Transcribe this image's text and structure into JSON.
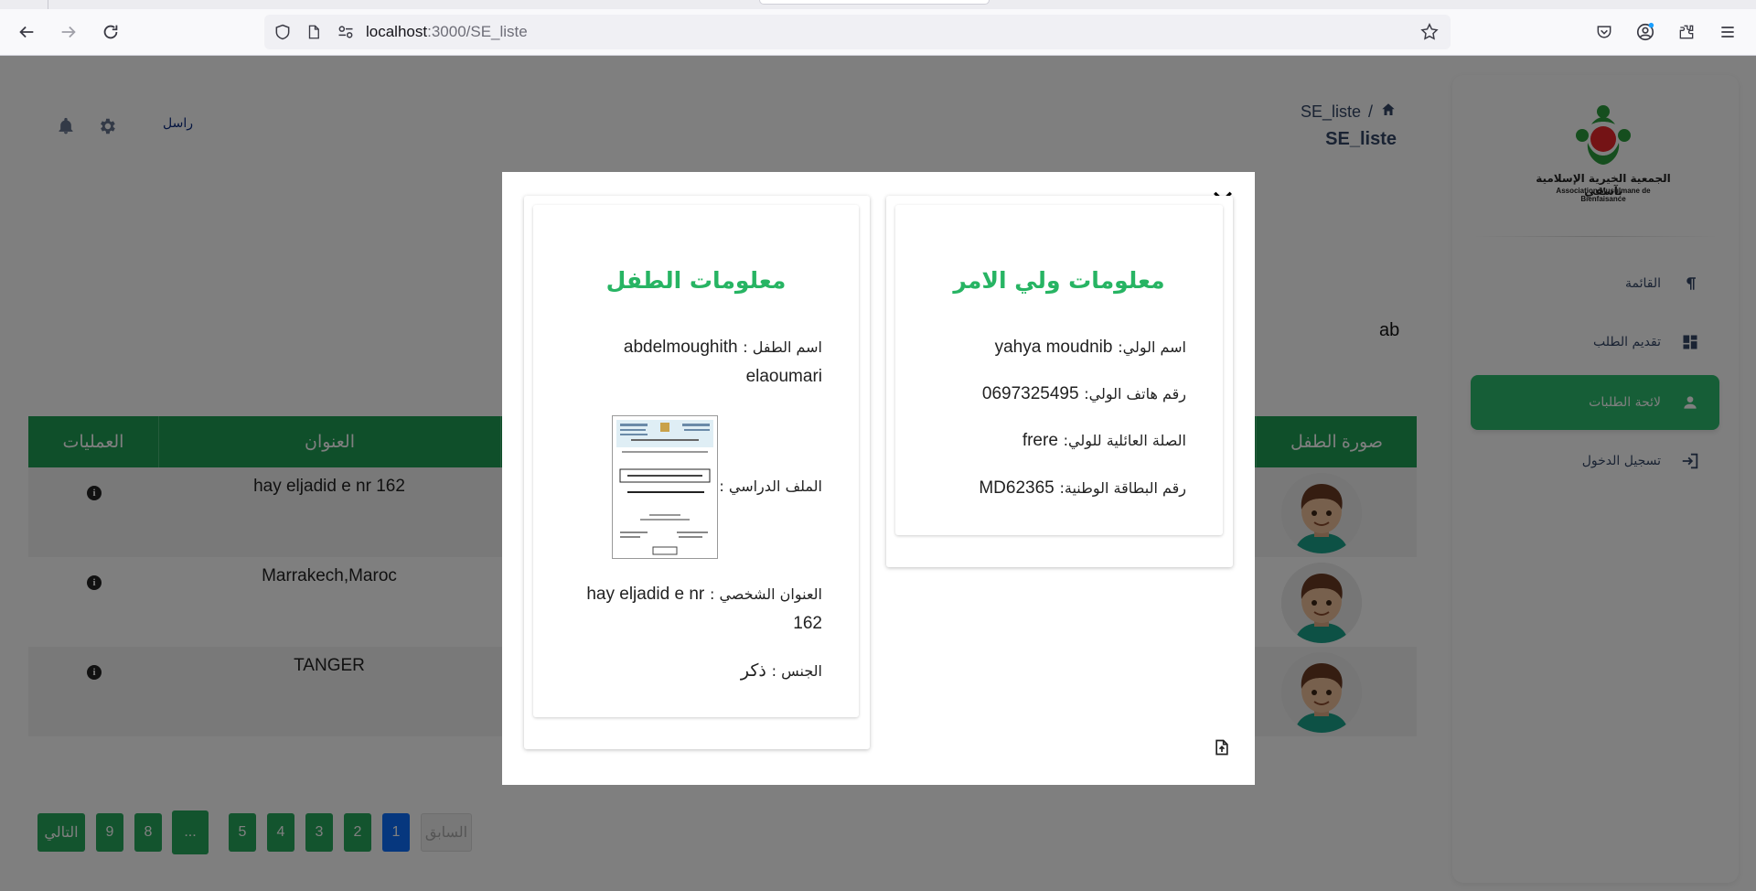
{
  "browser": {
    "url_host": "localhost",
    "url_path": ":3000/SE_liste"
  },
  "header": {
    "breadcrumb_current": "SE_liste",
    "breadcrumb_sep": "/",
    "page_title": "SE_liste",
    "message_link": "راسل"
  },
  "sidebar": {
    "logo_text_ar": "الجمعية الخيرية الإسلامية بآسفي",
    "logo_text_fr": "Association Musulmane de Bienfaisance",
    "items": [
      {
        "label": "القائمة",
        "icon": "pilcrow-icon"
      },
      {
        "label": "تقديم الطلب",
        "icon": "dashboard-icon"
      },
      {
        "label": "لائحة الطلبات",
        "icon": "person-icon"
      },
      {
        "label": "تسجيل الدخول",
        "icon": "login-icon"
      }
    ],
    "active_index": 2
  },
  "search": {
    "value": "ab"
  },
  "table": {
    "columns": [
      "العمليات",
      "العنوان",
      "صورة الطفل"
    ],
    "rows": [
      {
        "address": "hay eljadid e nr 162"
      },
      {
        "address": "Marrakech,Maroc"
      },
      {
        "address": "TANGER"
      }
    ]
  },
  "pagination": {
    "next": "التالي",
    "prev": "السابق",
    "pages": [
      "9",
      "8",
      "...",
      "5",
      "4",
      "3",
      "2",
      "1"
    ],
    "active": "1"
  },
  "modal": {
    "guardian": {
      "title": "معلومات ولي الامر",
      "name_label": "اسم الولي:",
      "name_value": "yahya moudnib",
      "phone_label": "رقم هاتف الولي:",
      "phone_value": "0697325495",
      "relation_label": "الصلة العائلية للولي:",
      "relation_value": "frere",
      "id_label": "رقم البطاقة الوطنية:",
      "id_value": "MD62365"
    },
    "child": {
      "title": "معلومات الطفل",
      "name_label": "اسم الطفل :",
      "name_value": "abdelmoughith elaoumari",
      "file_label": "الملف الدراسي :",
      "address_label": "العنوان الشخصي :",
      "address_value": "hay eljadid e nr 162",
      "gender_label": "الجنس :",
      "gender_value": "ذكر"
    }
  },
  "colors": {
    "accent_green": "#2dbd6e",
    "title_green": "#27b463",
    "header_green": "#1f9e54",
    "active_blue": "#0d6efd"
  }
}
